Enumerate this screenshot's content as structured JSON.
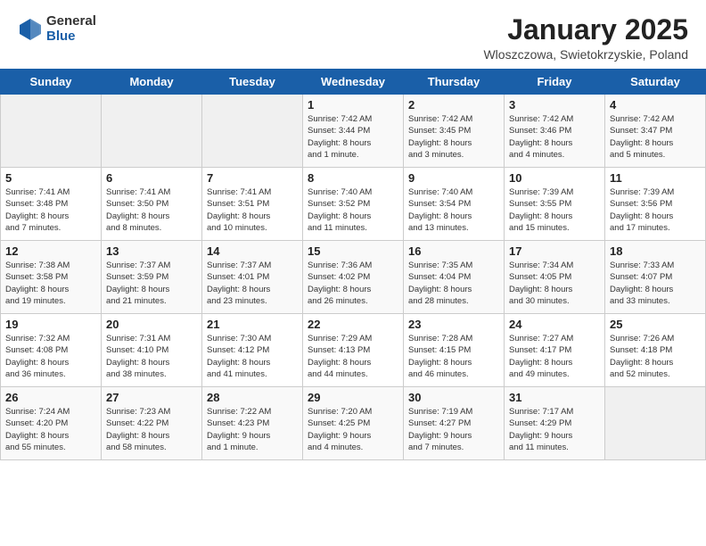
{
  "header": {
    "logo_general": "General",
    "logo_blue": "Blue",
    "month_title": "January 2025",
    "location": "Wloszczowa, Swietokrzyskie, Poland"
  },
  "weekdays": [
    "Sunday",
    "Monday",
    "Tuesday",
    "Wednesday",
    "Thursday",
    "Friday",
    "Saturday"
  ],
  "weeks": [
    [
      {
        "day": "",
        "info": ""
      },
      {
        "day": "",
        "info": ""
      },
      {
        "day": "",
        "info": ""
      },
      {
        "day": "1",
        "info": "Sunrise: 7:42 AM\nSunset: 3:44 PM\nDaylight: 8 hours\nand 1 minute."
      },
      {
        "day": "2",
        "info": "Sunrise: 7:42 AM\nSunset: 3:45 PM\nDaylight: 8 hours\nand 3 minutes."
      },
      {
        "day": "3",
        "info": "Sunrise: 7:42 AM\nSunset: 3:46 PM\nDaylight: 8 hours\nand 4 minutes."
      },
      {
        "day": "4",
        "info": "Sunrise: 7:42 AM\nSunset: 3:47 PM\nDaylight: 8 hours\nand 5 minutes."
      }
    ],
    [
      {
        "day": "5",
        "info": "Sunrise: 7:41 AM\nSunset: 3:48 PM\nDaylight: 8 hours\nand 7 minutes."
      },
      {
        "day": "6",
        "info": "Sunrise: 7:41 AM\nSunset: 3:50 PM\nDaylight: 8 hours\nand 8 minutes."
      },
      {
        "day": "7",
        "info": "Sunrise: 7:41 AM\nSunset: 3:51 PM\nDaylight: 8 hours\nand 10 minutes."
      },
      {
        "day": "8",
        "info": "Sunrise: 7:40 AM\nSunset: 3:52 PM\nDaylight: 8 hours\nand 11 minutes."
      },
      {
        "day": "9",
        "info": "Sunrise: 7:40 AM\nSunset: 3:54 PM\nDaylight: 8 hours\nand 13 minutes."
      },
      {
        "day": "10",
        "info": "Sunrise: 7:39 AM\nSunset: 3:55 PM\nDaylight: 8 hours\nand 15 minutes."
      },
      {
        "day": "11",
        "info": "Sunrise: 7:39 AM\nSunset: 3:56 PM\nDaylight: 8 hours\nand 17 minutes."
      }
    ],
    [
      {
        "day": "12",
        "info": "Sunrise: 7:38 AM\nSunset: 3:58 PM\nDaylight: 8 hours\nand 19 minutes."
      },
      {
        "day": "13",
        "info": "Sunrise: 7:37 AM\nSunset: 3:59 PM\nDaylight: 8 hours\nand 21 minutes."
      },
      {
        "day": "14",
        "info": "Sunrise: 7:37 AM\nSunset: 4:01 PM\nDaylight: 8 hours\nand 23 minutes."
      },
      {
        "day": "15",
        "info": "Sunrise: 7:36 AM\nSunset: 4:02 PM\nDaylight: 8 hours\nand 26 minutes."
      },
      {
        "day": "16",
        "info": "Sunrise: 7:35 AM\nSunset: 4:04 PM\nDaylight: 8 hours\nand 28 minutes."
      },
      {
        "day": "17",
        "info": "Sunrise: 7:34 AM\nSunset: 4:05 PM\nDaylight: 8 hours\nand 30 minutes."
      },
      {
        "day": "18",
        "info": "Sunrise: 7:33 AM\nSunset: 4:07 PM\nDaylight: 8 hours\nand 33 minutes."
      }
    ],
    [
      {
        "day": "19",
        "info": "Sunrise: 7:32 AM\nSunset: 4:08 PM\nDaylight: 8 hours\nand 36 minutes."
      },
      {
        "day": "20",
        "info": "Sunrise: 7:31 AM\nSunset: 4:10 PM\nDaylight: 8 hours\nand 38 minutes."
      },
      {
        "day": "21",
        "info": "Sunrise: 7:30 AM\nSunset: 4:12 PM\nDaylight: 8 hours\nand 41 minutes."
      },
      {
        "day": "22",
        "info": "Sunrise: 7:29 AM\nSunset: 4:13 PM\nDaylight: 8 hours\nand 44 minutes."
      },
      {
        "day": "23",
        "info": "Sunrise: 7:28 AM\nSunset: 4:15 PM\nDaylight: 8 hours\nand 46 minutes."
      },
      {
        "day": "24",
        "info": "Sunrise: 7:27 AM\nSunset: 4:17 PM\nDaylight: 8 hours\nand 49 minutes."
      },
      {
        "day": "25",
        "info": "Sunrise: 7:26 AM\nSunset: 4:18 PM\nDaylight: 8 hours\nand 52 minutes."
      }
    ],
    [
      {
        "day": "26",
        "info": "Sunrise: 7:24 AM\nSunset: 4:20 PM\nDaylight: 8 hours\nand 55 minutes."
      },
      {
        "day": "27",
        "info": "Sunrise: 7:23 AM\nSunset: 4:22 PM\nDaylight: 8 hours\nand 58 minutes."
      },
      {
        "day": "28",
        "info": "Sunrise: 7:22 AM\nSunset: 4:23 PM\nDaylight: 9 hours\nand 1 minute."
      },
      {
        "day": "29",
        "info": "Sunrise: 7:20 AM\nSunset: 4:25 PM\nDaylight: 9 hours\nand 4 minutes."
      },
      {
        "day": "30",
        "info": "Sunrise: 7:19 AM\nSunset: 4:27 PM\nDaylight: 9 hours\nand 7 minutes."
      },
      {
        "day": "31",
        "info": "Sunrise: 7:17 AM\nSunset: 4:29 PM\nDaylight: 9 hours\nand 11 minutes."
      },
      {
        "day": "",
        "info": ""
      }
    ]
  ]
}
